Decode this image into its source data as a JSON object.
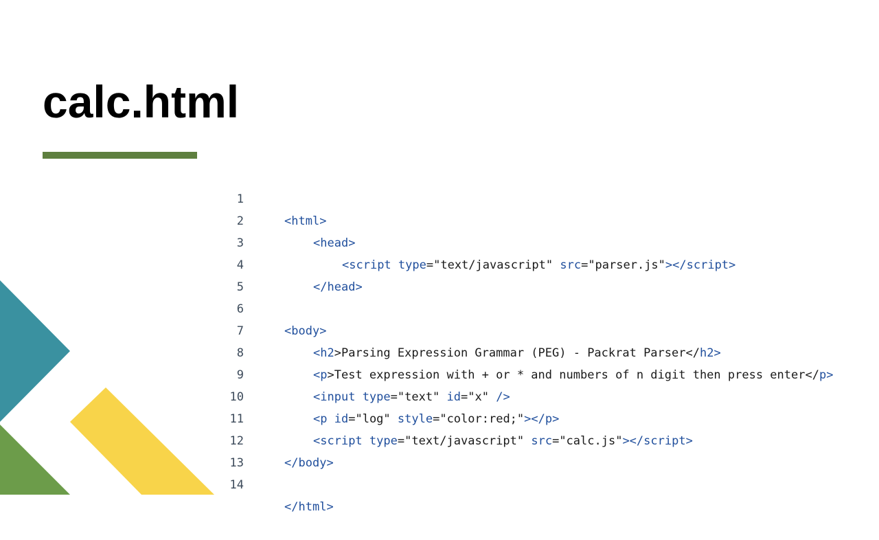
{
  "slide": {
    "title": "calc.html",
    "colors": {
      "accent": "#5e7f3f",
      "teal": "#3a91a0",
      "yellow": "#f8d44a",
      "green": "#6c9c4a",
      "tag": "#1f4e9c"
    }
  },
  "code": {
    "lines": [
      {
        "n": "1",
        "p1": "<",
        "tag": "html",
        "p2": ">"
      },
      {
        "n": "2",
        "p1": "<",
        "tag": "head",
        "p2": ">"
      },
      {
        "n": "3",
        "p1": "<",
        "tag": "script",
        "a1": "type",
        "v1": "=\"text/javascript\"",
        "a2": "src",
        "v2": "=\"parser.js\"",
        "close": "></",
        "tag2": "script",
        "p2": ">"
      },
      {
        "n": "4",
        "p1": "</",
        "tag": "head",
        "p2": ">"
      },
      {
        "n": "5"
      },
      {
        "n": "6",
        "p1": "<",
        "tag": "body",
        "p2": ">"
      },
      {
        "n": "7",
        "p1": "<",
        "tag": "h2",
        "text": ">Parsing Expression Grammar (PEG) - Packrat Parser</",
        "tag2": "h2",
        "p2": ">"
      },
      {
        "n": "8",
        "p1": "<",
        "tag": "p",
        "text": ">Test expression with + or * and numbers of n digit then press enter</",
        "tag2": "p",
        "p2": ">"
      },
      {
        "n": "9",
        "p1": "<",
        "tag": "input",
        "a1": "type",
        "v1": "=\"text\"",
        "a2": "id",
        "v2": "=\"x\"",
        "p2": " />"
      },
      {
        "n": "10",
        "p1": "<",
        "tag": "p",
        "a1": "id",
        "v1": "=\"log\"",
        "a2": "style",
        "v2": "=\"color:red;\"",
        "close": "></",
        "tag2": "p",
        "p2": ">"
      },
      {
        "n": "11",
        "p1": "<",
        "tag": "script",
        "a1": "type",
        "v1": "=\"text/javascript\"",
        "a2": "src",
        "v2": "=\"calc.js\"",
        "close": "></",
        "tag2": "script",
        "p2": ">"
      },
      {
        "n": "12",
        "p1": "</",
        "tag": "body",
        "p2": ">"
      },
      {
        "n": "13"
      },
      {
        "n": "14",
        "p1": "</",
        "tag": "html",
        "p2": ">"
      }
    ]
  }
}
